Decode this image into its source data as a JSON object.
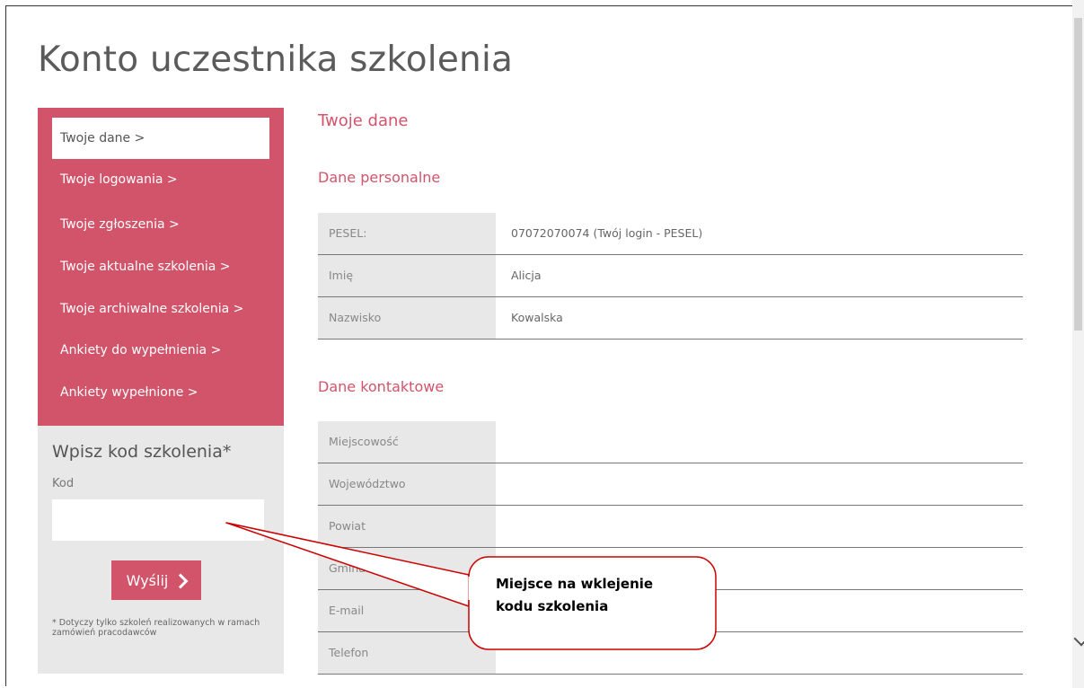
{
  "page": {
    "title": "Konto uczestnika szkolenia"
  },
  "sidebar": {
    "items": [
      {
        "label": "Twoje dane >",
        "active": true
      },
      {
        "label": "Twoje logowania >"
      },
      {
        "label": "Twoje zgłoszenia >"
      },
      {
        "label": "Twoje aktualne szkolenia >"
      },
      {
        "label": "Twoje archiwalne szkolenia >"
      },
      {
        "label": "Ankiety do wypełnienia >"
      },
      {
        "label": "Ankiety wypełnione >"
      }
    ]
  },
  "code_form": {
    "title": "Wpisz kod szkolenia*",
    "label": "Kod",
    "input_value": "",
    "button_label": "Wyślij",
    "button_icon": "chevron-right-icon",
    "footnote": "* Dotyczy tylko szkoleń realizowanych w ramach zamówień pracodawców"
  },
  "main": {
    "title": "Twoje dane",
    "personal": {
      "heading": "Dane personalne",
      "rows": [
        {
          "label": "PESEL:",
          "value": "07072070074 (Twój login - PESEL)"
        },
        {
          "label": "Imię",
          "value": "Alicja"
        },
        {
          "label": "Nazwisko",
          "value": "Kowalska"
        }
      ]
    },
    "contact": {
      "heading": "Dane kontaktowe",
      "rows": [
        {
          "label": "Miejscowość",
          "value": ""
        },
        {
          "label": "Województwo",
          "value": ""
        },
        {
          "label": "Powiat",
          "value": ""
        },
        {
          "label": "Gmina",
          "value": ""
        },
        {
          "label": "E-mail",
          "value": ""
        },
        {
          "label": "Telefon",
          "value": ""
        }
      ]
    }
  },
  "callout": {
    "line1": "Miejsce na wklejenie",
    "line2": "kodu szkolenia"
  },
  "colors": {
    "accent": "#d2546a",
    "panel": "#e8e8e8",
    "callout": "#cc0000"
  }
}
